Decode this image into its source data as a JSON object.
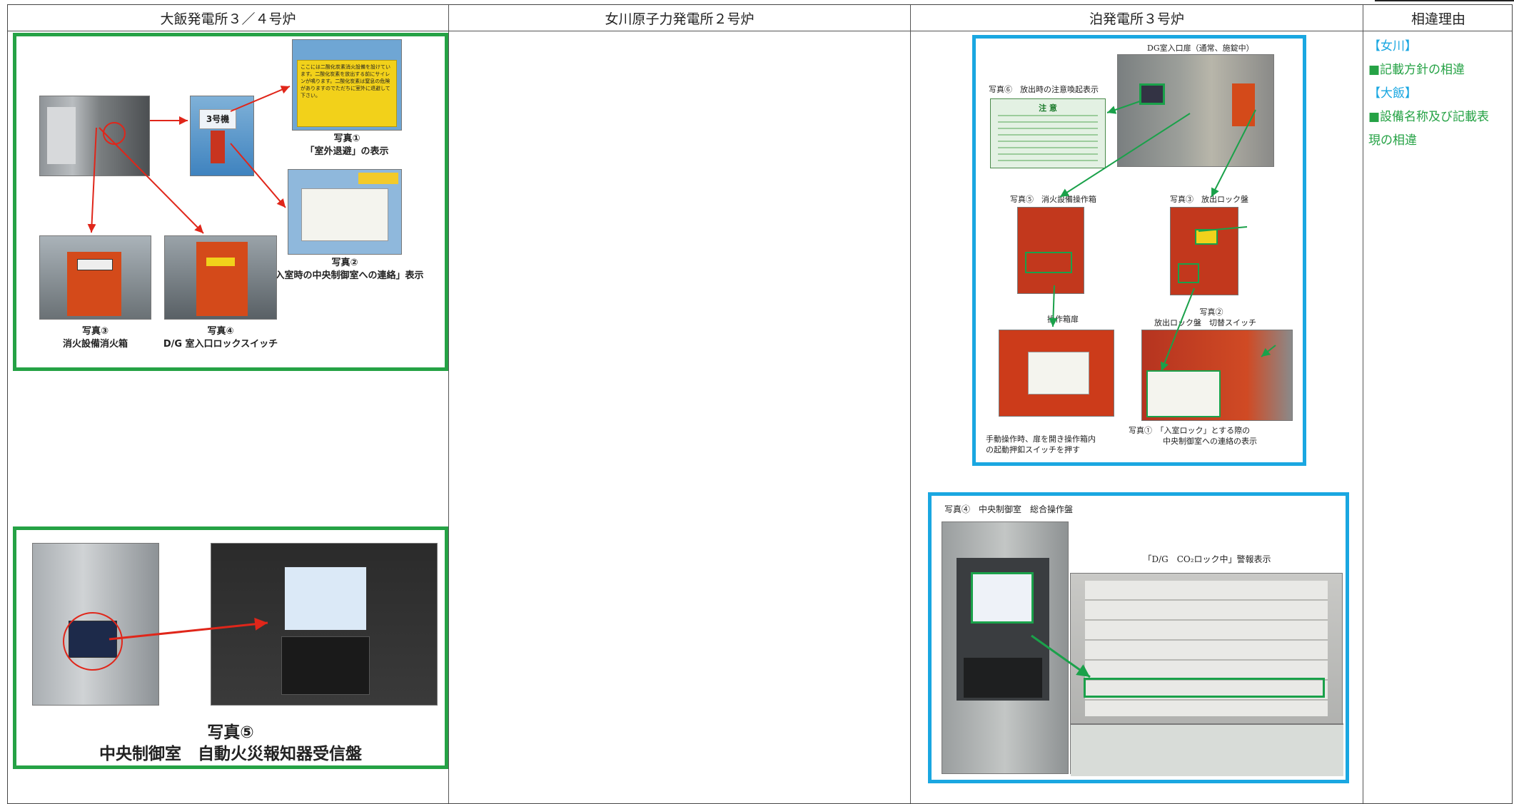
{
  "table": {
    "columns": [
      {
        "label": "大飯発電所３／４号炉"
      },
      {
        "label": "女川原子力発電所２号炉"
      },
      {
        "label": "泊発電所３号炉"
      },
      {
        "label": "相違理由"
      }
    ]
  },
  "ohi_panel": {
    "sign_text": "ここには二酸化炭素消火設備を設けています。二酸化炭素を放出する前にサイレンが鳴ります。二酸化炭素は窒息の危険がありますのでただちに室外に退避して下さい。",
    "unit_label": "3号機",
    "photo1_caption": [
      "写真①",
      "「室外退避」の表示"
    ],
    "photo2_caption": [
      "写真②",
      "「入室時の中央制御室への連絡」表示"
    ],
    "photo3_caption": [
      "写真③",
      "消火設備消火箱"
    ],
    "photo4_caption": [
      "写真④",
      "D/G 室入口ロックスイッチ"
    ]
  },
  "ohi_panel2": {
    "photo5_caption": [
      "写真⑤",
      "中央制御室　自動火災報知器受信盤"
    ]
  },
  "tomari_panel": {
    "entrance_label": "DG室入口扉（通常、施錠中）",
    "photo6_label": "写真⑥　放出時の注意喚起表示",
    "caution_title": "注 意",
    "photo5_label": "写真⑤　消火設備操作箱",
    "photo3_label": "写真③　放出ロック盤",
    "photo2_label": [
      "写真②",
      "放出ロック盤　切替スイッチ"
    ],
    "door_label": "操作箱扉",
    "manual_note": [
      "手動操作時、扉を開き操作箱内",
      "の起動押釦スイッチを押す"
    ],
    "photo1_label": [
      "写真①　「入室ロック」とする際の",
      "中央制御室への連絡の表示"
    ]
  },
  "tomari_panel2": {
    "photo4_label": "写真④　中央制御室　総合操作盤",
    "alarm_label": "「D/G　CO₂ロック中」警報表示"
  },
  "reasons": {
    "onagawa_tag": "【女川】",
    "onagawa_text": "■記載方針の相違",
    "ohi_tag": "【大飯】",
    "ohi_text_1": "■設備名称及び記載表",
    "ohi_text_2": "現の相違"
  },
  "colors": {
    "green_frame": "#25a245",
    "blue_frame": "#1aa7e1",
    "arrow_red": "#e0261a",
    "arrow_green": "#1aa14a"
  }
}
